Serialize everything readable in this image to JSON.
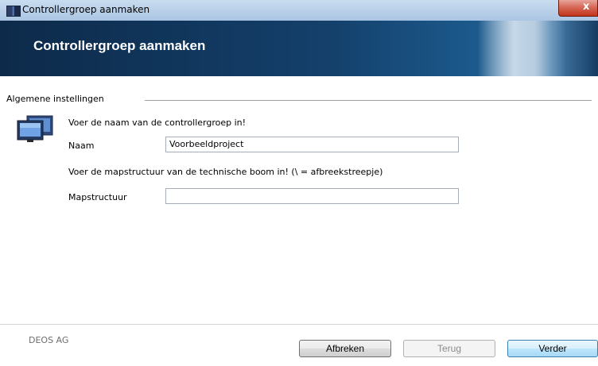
{
  "window": {
    "title": "Controllergroep aanmaken",
    "close_label": "x"
  },
  "banner": {
    "title": "Controllergroep aanmaken"
  },
  "group": {
    "label": "Algemene instellingen"
  },
  "form": {
    "name_prompt": "Voer de naam van de controllergroep in!",
    "name_label": "Naam",
    "name_value": "Voorbeeldproject",
    "folder_prompt": "Voer de mapstructuur van de technische boom in! (\\ = afbreekstreepje)",
    "folder_label": "Mapstructuur",
    "folder_value": ""
  },
  "footer": {
    "company": "DEOS AG",
    "cancel_label": "Afbreken",
    "back_label": "Terug",
    "next_label": "Verder"
  },
  "icons": {
    "app": "app-icon",
    "monitor": "monitor-icon",
    "close": "close-icon"
  }
}
